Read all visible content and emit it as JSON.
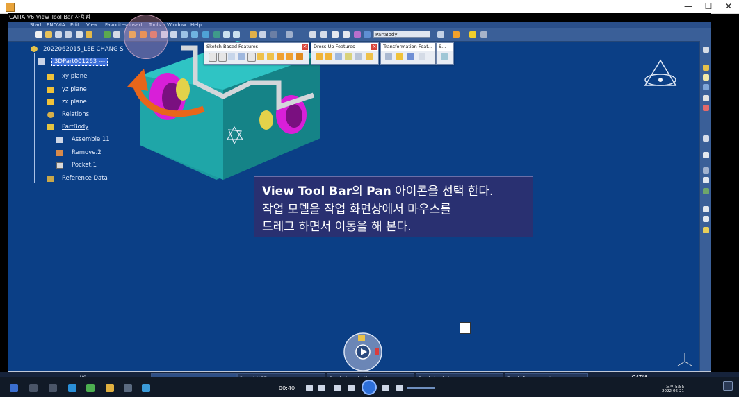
{
  "window": {
    "title": "CATIA V6 View Tool Bar 사용법",
    "minimize": "—",
    "maximize": "☐",
    "close": "✕"
  },
  "menu": {
    "items": [
      "Start",
      "ENOVIA",
      "Edit",
      "View",
      "Favorites",
      "Insert",
      "Tools",
      "Window",
      "Help"
    ]
  },
  "toolbar": {
    "body_select": "PartBody"
  },
  "floating_toolbars": [
    {
      "title": "Sketch-Based Features"
    },
    {
      "title": "Dress-Up Features"
    },
    {
      "title": "Transformation Feat..."
    },
    {
      "title": "S..."
    }
  ],
  "spec_tree": {
    "root_label": "2022062015_LEE CHANG S",
    "part_label": "3DPart001263 ---",
    "items": [
      {
        "label": "xy plane"
      },
      {
        "label": "yz plane"
      },
      {
        "label": "zx plane"
      },
      {
        "label": "Relations"
      },
      {
        "label": "PartBody"
      },
      {
        "label": "Assemble.11"
      },
      {
        "label": "Remove.2"
      },
      {
        "label": "Pocket.1"
      },
      {
        "label": "Reference Data"
      }
    ]
  },
  "caption": {
    "line1_bold1": "View Tool Bar",
    "line1_mid": "의 ",
    "line1_bold2": "Pan",
    "line1_rest": " 아이콘을 선택 한다.",
    "line2": "작업 모델을 작업 화면상에서 마우스를",
    "line3": "드레그 하면서 이동을 해 본다."
  },
  "player": {
    "time": "00:40",
    "tasks": [
      {
        "label": "V6"
      },
      {
        "label": "3dpart *LEE*"
      },
      {
        "label": "Ready for selection"
      },
      {
        "label": "Ready to chat"
      },
      {
        "label": "Ready for propagate"
      }
    ],
    "brand": "CATIA"
  },
  "taskbar": {
    "clock_time": "오후 5:55",
    "clock_date": "2022-06-21"
  },
  "colors": {
    "viewport_bg": "#0b3f86",
    "model_teal": "#1fa6a8",
    "model_magenta": "#d81fd8",
    "arrow_orange": "#e8661a",
    "caption_bg": "#2d2f6e"
  }
}
